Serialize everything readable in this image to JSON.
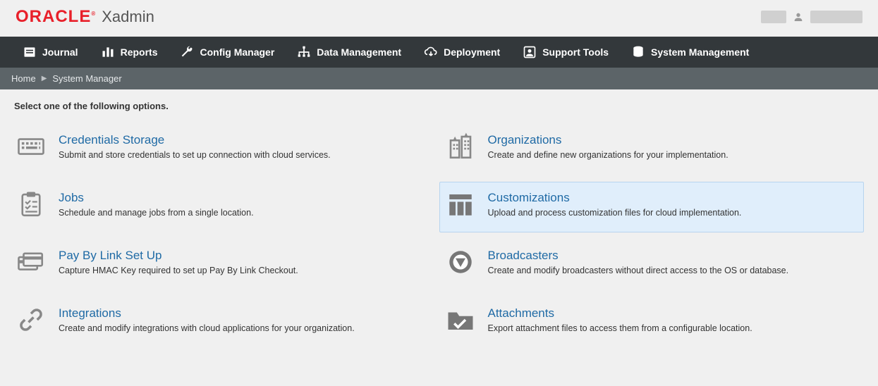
{
  "brand": {
    "logo": "ORACLE",
    "tm": "®",
    "sub": "Xadmin"
  },
  "nav": [
    {
      "id": "journal",
      "label": "Journal"
    },
    {
      "id": "reports",
      "label": "Reports"
    },
    {
      "id": "config-manager",
      "label": "Config Manager"
    },
    {
      "id": "data-management",
      "label": "Data Management"
    },
    {
      "id": "deployment",
      "label": "Deployment"
    },
    {
      "id": "support-tools",
      "label": "Support Tools"
    },
    {
      "id": "system-management",
      "label": "System Management"
    }
  ],
  "breadcrumb": {
    "home": "Home",
    "current": "System Manager"
  },
  "content": {
    "title": "Select one of the following options.",
    "options": [
      {
        "id": "credentials-storage",
        "title": "Credentials Storage",
        "desc": "Submit and store credentials to set up connection with cloud services."
      },
      {
        "id": "organizations",
        "title": "Organizations",
        "desc": "Create and define new organizations for your implementation."
      },
      {
        "id": "jobs",
        "title": "Jobs",
        "desc": "Schedule and manage jobs from a single location."
      },
      {
        "id": "customizations",
        "title": "Customizations",
        "desc": "Upload and process customization files for cloud implementation."
      },
      {
        "id": "pay-by-link",
        "title": "Pay By Link Set Up",
        "desc": "Capture HMAC Key required to set up Pay By Link Checkout."
      },
      {
        "id": "broadcasters",
        "title": "Broadcasters",
        "desc": "Create and modify broadcasters without direct access to the OS or database."
      },
      {
        "id": "integrations",
        "title": "Integrations",
        "desc": "Create and modify integrations with cloud applications for your organization."
      },
      {
        "id": "attachments",
        "title": "Attachments",
        "desc": "Export attachment files to access them from a configurable location."
      }
    ]
  }
}
